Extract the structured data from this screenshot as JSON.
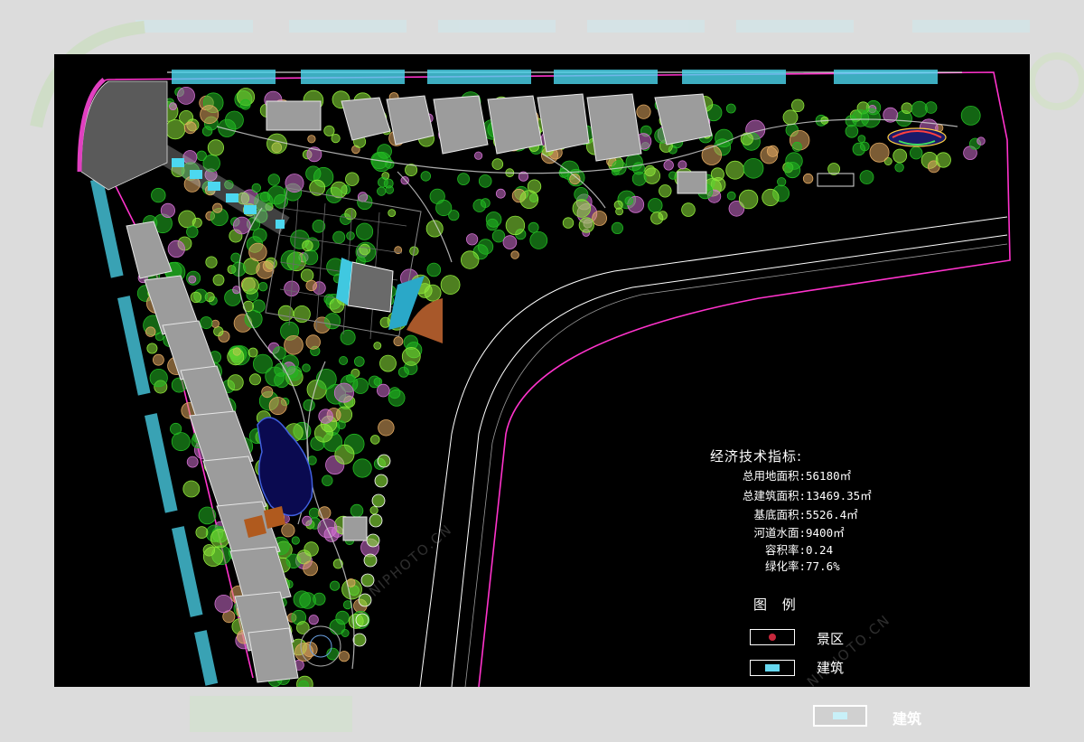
{
  "technical_indicators": {
    "title": "经济技术指标:",
    "rows": [
      {
        "label": "总用地面积:",
        "value": "56180㎡"
      },
      {
        "label": "总建筑面积:",
        "value": "13469.35㎡"
      },
      {
        "label": "基底面积:",
        "value": "5526.4㎡"
      },
      {
        "label": "河道水面:",
        "value": "9400㎡"
      },
      {
        "label": "容积率:",
        "value": "0.24"
      },
      {
        "label": "绿化率:",
        "value": "77.6%"
      }
    ]
  },
  "legend": {
    "title": "图 例",
    "items": [
      {
        "label": "景区",
        "swatch": "#c8283c"
      },
      {
        "label": "建筑",
        "swatch": "#66d8f0"
      }
    ]
  },
  "outside_legend_label": "建筑",
  "watermark": "NIPHOTO.CN",
  "colors": {
    "background": "#000000",
    "boundary": "#ff33cc",
    "tree_green": "#22b822",
    "tree_light": "#8ee83a",
    "tree_orange": "#e0a860",
    "tree_pink": "#d070d0",
    "building_cyan": "#4cd8f0",
    "roof_gray": "#b8b8b8",
    "road_line": "#ffffff"
  }
}
